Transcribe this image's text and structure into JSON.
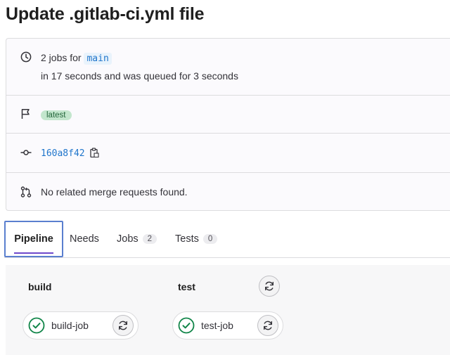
{
  "page": {
    "title": "Update .gitlab-ci.yml file"
  },
  "info": {
    "jobs_prefix": "2 jobs for",
    "branch": "main",
    "duration_text": "in 17 seconds and was queued for 3 seconds",
    "badge": "latest",
    "commit_sha": "160a8f42",
    "merge_requests_text": "No related merge requests found."
  },
  "tabs": [
    {
      "label": "Pipeline",
      "active": true
    },
    {
      "label": "Needs"
    },
    {
      "label": "Jobs",
      "count": "2"
    },
    {
      "label": "Tests",
      "count": "0"
    }
  ],
  "stages": [
    {
      "name": "build",
      "jobs": [
        {
          "name": "build-job",
          "status": "passed"
        }
      ]
    },
    {
      "name": "test",
      "jobs": [
        {
          "name": "test-job",
          "status": "passed"
        }
      ]
    }
  ],
  "colors": {
    "success": "#108548",
    "link": "#1f75cb",
    "active_tab_border": "#5a7fcf",
    "tab_underline": "#6e49cb"
  }
}
